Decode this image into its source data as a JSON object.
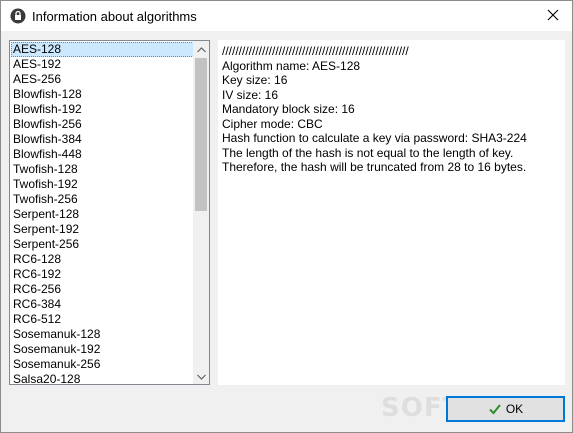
{
  "window": {
    "title": "Information about algorithms",
    "close_icon": "close-icon"
  },
  "algorithm_list": {
    "items": [
      "AES-128",
      "AES-192",
      "AES-256",
      "Blowfish-128",
      "Blowfish-192",
      "Blowfish-256",
      "Blowfish-384",
      "Blowfish-448",
      "Twofish-128",
      "Twofish-192",
      "Twofish-256",
      "Serpent-128",
      "Serpent-192",
      "Serpent-256",
      "RC6-128",
      "RC6-192",
      "RC6-256",
      "RC6-384",
      "RC6-512",
      "Sosemanuk-128",
      "Sosemanuk-192",
      "Sosemanuk-256",
      "Salsa20-128"
    ],
    "selected_index": 0
  },
  "info": {
    "text": "////////////////////////////////////////////////////////\nAlgorithm name: AES-128\nKey size: 16\nIV size: 16\nMandatory block size: 16\nCipher mode: CBC\nHash function to calculate a key via password: SHA3-224\nThe length of the hash is not equal to the length of key. Therefore, the hash will be truncated from 28 to 16 bytes."
  },
  "buttons": {
    "ok_label": "OK"
  },
  "watermark": "SOFTPEDIA",
  "colors": {
    "selection": "#cce8ff",
    "accent": "#0078d7"
  }
}
